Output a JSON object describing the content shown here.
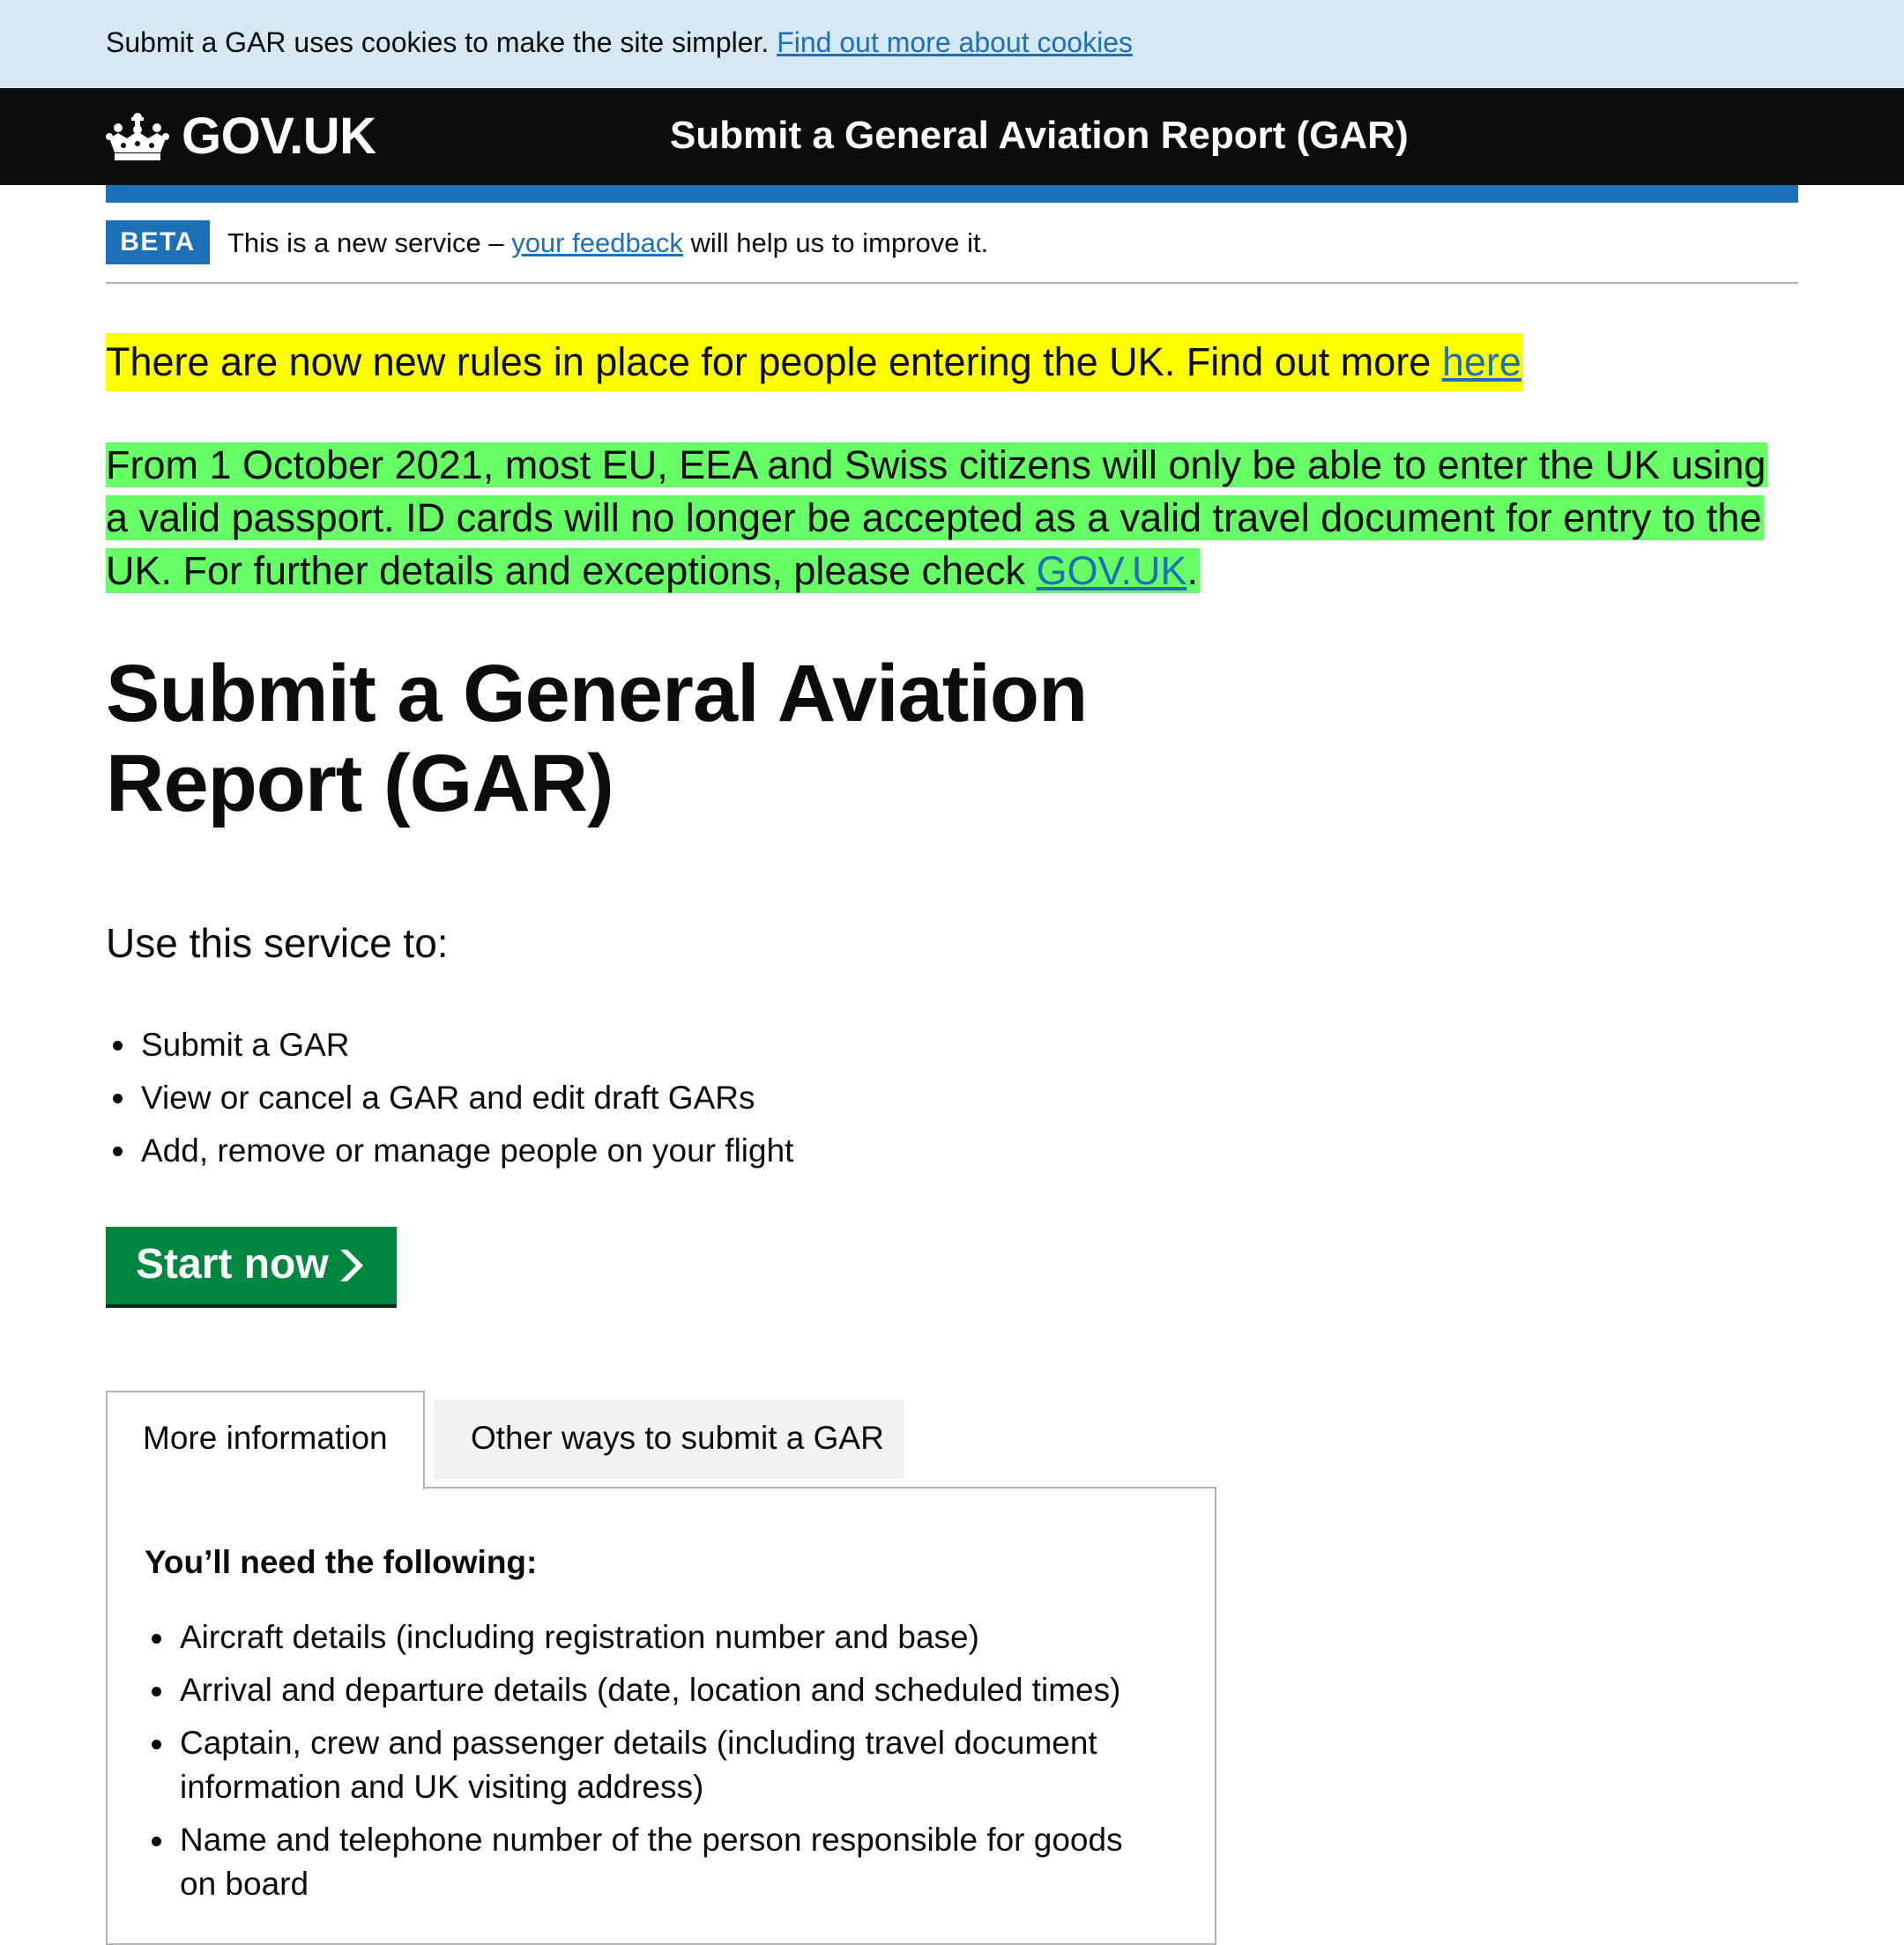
{
  "cookie_banner": {
    "text": "Submit a GAR uses cookies to make the site simpler.",
    "link": "Find out more about cookies"
  },
  "header": {
    "logo_text": "GOV.UK",
    "service_name": "Submit a General Aviation Report (GAR)",
    "logo_icon": "crown-icon"
  },
  "phase_banner": {
    "tag": "BETA",
    "text_before": "This is a new service –",
    "link": "your feedback",
    "text_after": "will help us to improve it."
  },
  "notices": {
    "yellow_text": "There are now new rules in place for people entering the UK. Find out more",
    "yellow_link": "here",
    "yellow_color": "#ffff00",
    "green_text": "From 1 October 2021, most EU, EEA and Swiss citizens will only be able to enter the UK using a valid passport. ID cards will no longer be accepted as a valid travel document for entry to the UK. For further details and exceptions, please check",
    "green_link": "GOV.UK",
    "green_end": ".",
    "green_color": "#66ff66"
  },
  "main": {
    "title": "Submit a General Aviation Report (GAR)",
    "lead": "Use this service to:",
    "service_items": [
      "Submit a GAR",
      "View or cancel a GAR and edit draft GARs",
      "Add, remove or manage people on your flight"
    ],
    "start_button": "Start now",
    "start_icon": "chevron-right-icon",
    "button_color": "#00873f"
  },
  "tabs": [
    {
      "label": "More information",
      "selected": true
    },
    {
      "label": "Other ways to submit a GAR",
      "selected": false
    }
  ],
  "tab_panel": {
    "heading": "You’ll need the following:",
    "items": [
      "Aircraft details (including registration number and base)",
      "Arrival and departure details (date, location and scheduled times)",
      "Captain, crew and passenger details (including travel document information and UK visiting address)",
      "Name and telephone number of the person responsible for goods on board"
    ]
  }
}
